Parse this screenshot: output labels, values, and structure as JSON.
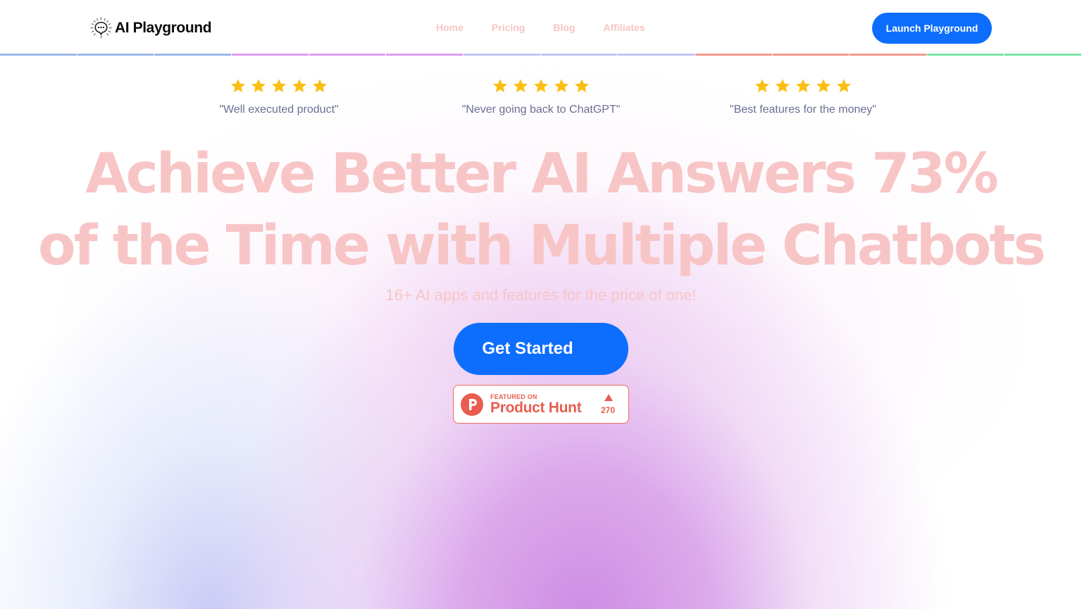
{
  "header": {
    "logo_text": "AI Playground",
    "logo_icon": "chat-bubble-sparkle-icon",
    "nav": [
      {
        "label": "Home"
      },
      {
        "label": "Pricing"
      },
      {
        "label": "Blog"
      },
      {
        "label": "Affiliates"
      }
    ],
    "launch_label": "Launch Playground"
  },
  "divider_colors": [
    "#9db8e8",
    "#dc9df0",
    "#c0c6f4",
    "#f59a8b",
    "#7ce3a8"
  ],
  "reviews": [
    {
      "stars": 5,
      "quote": "\"Well executed product\""
    },
    {
      "stars": 5,
      "quote": "\"Never going back to ChatGPT\""
    },
    {
      "stars": 5,
      "quote": "\"Best features for the money\""
    }
  ],
  "hero": {
    "title_line1": "Achieve Better AI Answers 73%",
    "title_line2": "of the Time with Multiple Chatbots",
    "subtitle": "16+ AI apps and features for the price of one!",
    "cta_label": "Get Started"
  },
  "product_hunt": {
    "featured_label": "FEATURED ON",
    "name": "Product Hunt",
    "upvotes": "270",
    "brand_color": "#e85d4f"
  },
  "colors": {
    "primary": "#0d6efd",
    "star": "#fbbf14",
    "accent_pink": "#f8c5c6"
  }
}
